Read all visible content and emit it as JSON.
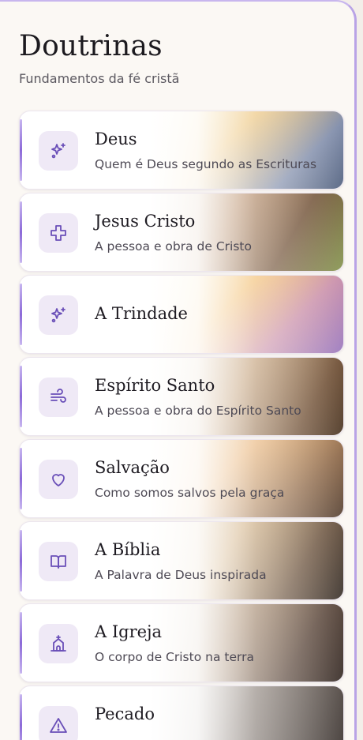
{
  "header": {
    "title": "Doutrinas",
    "subtitle": "Fundamentos da fé cristã"
  },
  "accent_color": "#6a4fb8",
  "items": [
    {
      "title": "Deus",
      "description": "Quem é Deus segundo as Escrituras",
      "icon": "sparkles-icon"
    },
    {
      "title": "Jesus Cristo",
      "description": "A pessoa e obra de Cristo",
      "icon": "cross-icon"
    },
    {
      "title": "A Trindade",
      "description": "",
      "icon": "sparkles-icon"
    },
    {
      "title": "Espírito Santo",
      "description": "A pessoa e obra do Espírito Santo",
      "icon": "wind-icon"
    },
    {
      "title": "Salvação",
      "description": "Como somos salvos pela graça",
      "icon": "heart-icon"
    },
    {
      "title": "A Bíblia",
      "description": "A Palavra de Deus inspirada",
      "icon": "book-open-icon"
    },
    {
      "title": "A Igreja",
      "description": "O corpo de Cristo na terra",
      "icon": "church-icon"
    },
    {
      "title": "Pecado",
      "description": "",
      "icon": "warning-icon"
    }
  ]
}
